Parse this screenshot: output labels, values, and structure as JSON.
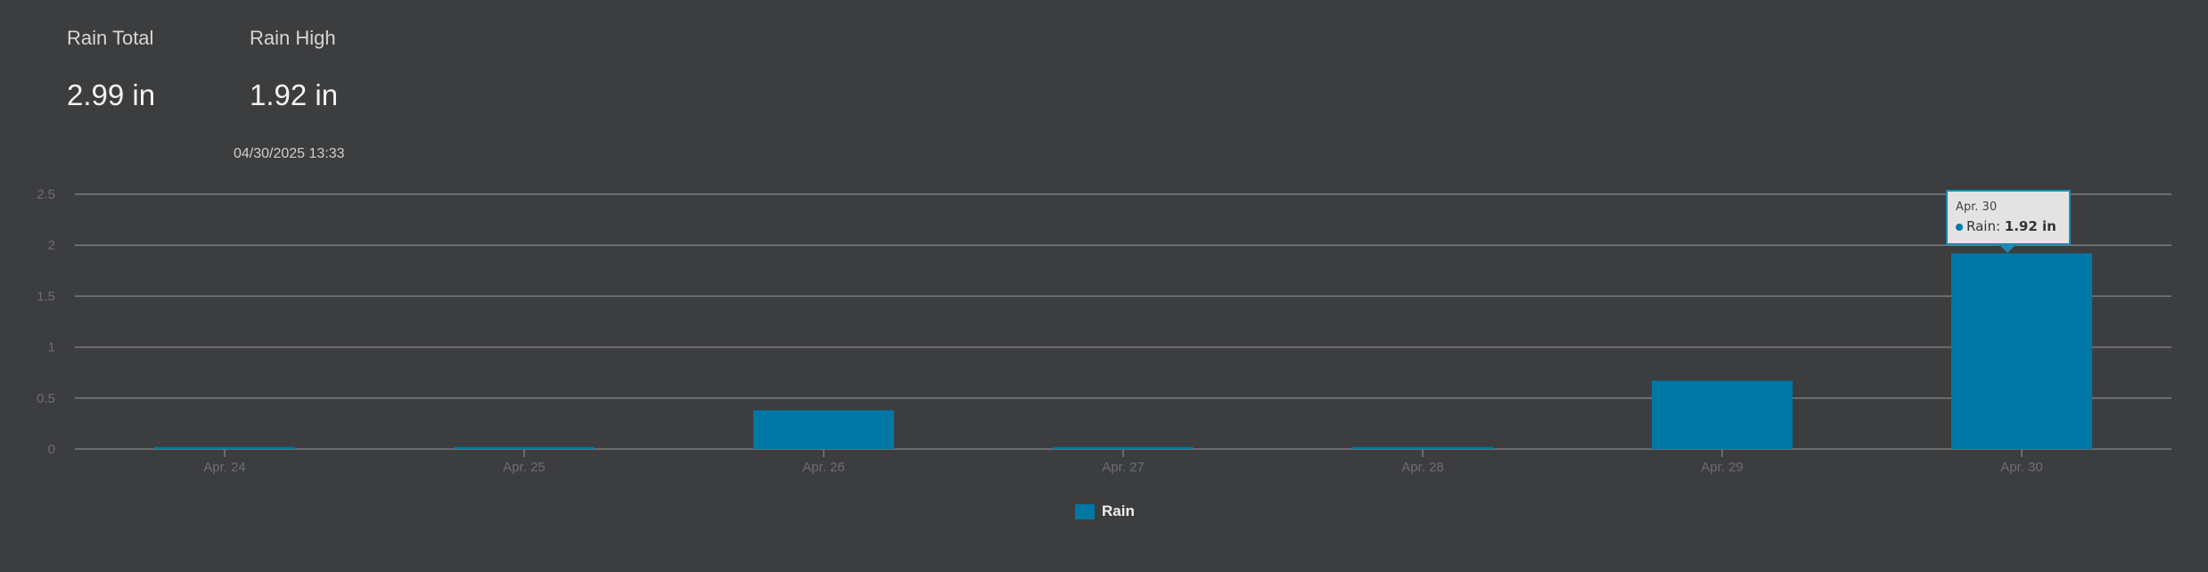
{
  "stats": {
    "total": {
      "label": "Rain Total",
      "value": "2.99 in"
    },
    "high": {
      "label": "Rain High",
      "value": "1.92 in",
      "time": "04/30/2025 13:33"
    }
  },
  "colors": {
    "background": "#3c3d3f",
    "series": "#0078a6",
    "grid": "#7a7b7d",
    "axis_text": "#6d6e70"
  },
  "tooltip": {
    "title": "Apr. 30",
    "series_name": "Rain",
    "value": "1.92 in"
  },
  "chart_data": {
    "type": "bar",
    "categories": [
      "Apr. 24",
      "Apr. 25",
      "Apr. 26",
      "Apr. 27",
      "Apr. 28",
      "Apr. 29",
      "Apr. 30"
    ],
    "series": [
      {
        "name": "Rain",
        "values": [
          0.02,
          0.02,
          0.38,
          0.02,
          0.02,
          0.67,
          1.92
        ]
      }
    ],
    "ylim": [
      0,
      2.5
    ],
    "yticks": [
      "0",
      "0.5",
      "1",
      "1.5",
      "2",
      "2.5"
    ],
    "ytick_values": [
      0,
      0.5,
      1,
      1.5,
      2,
      2.5
    ],
    "grid": true,
    "legend": "bottom-center",
    "xlabel": "",
    "ylabel": ""
  }
}
